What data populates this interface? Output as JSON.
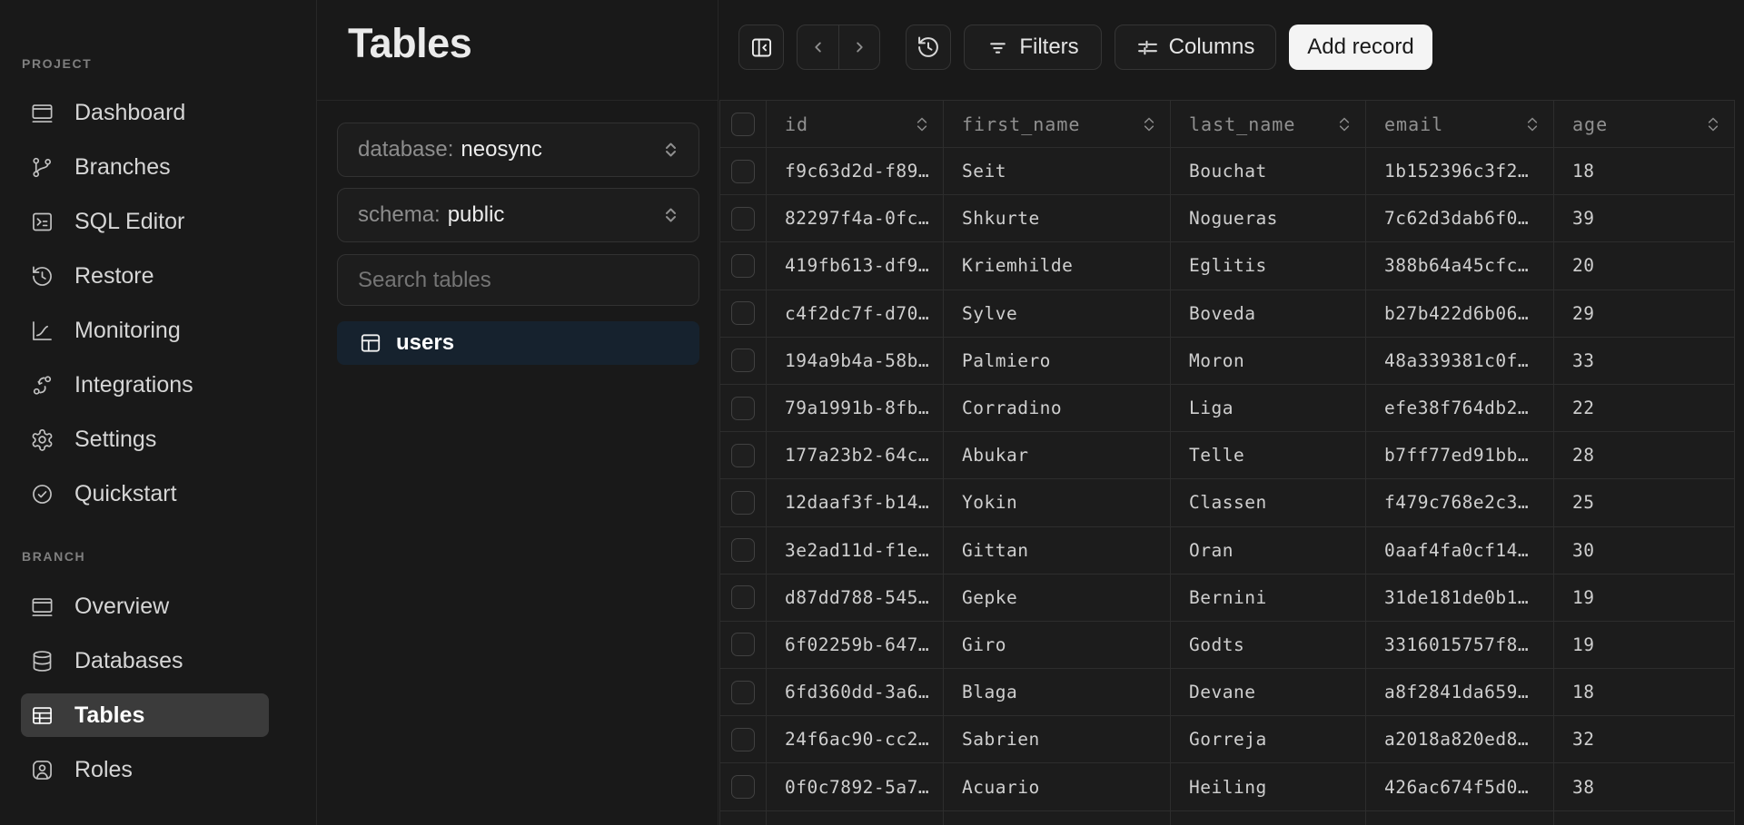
{
  "sidebar": {
    "project": {
      "label": "PROJECT",
      "items": [
        "Dashboard",
        "Branches",
        "SQL Editor",
        "Restore",
        "Monitoring",
        "Integrations",
        "Settings",
        "Quickstart"
      ]
    },
    "branch": {
      "label": "BRANCH",
      "items": [
        "Overview",
        "Databases",
        "Tables",
        "Roles"
      ],
      "active_item": "Tables"
    }
  },
  "panel": {
    "title": "Tables",
    "database_select": {
      "label": "database:",
      "value": "neosync"
    },
    "schema_select": {
      "label": "schema:",
      "value": "public"
    },
    "search": {
      "placeholder": "Search tables"
    },
    "tables": [
      {
        "name": "users",
        "active": true
      }
    ]
  },
  "toolbar": {
    "filters_label": "Filters",
    "columns_label": "Columns",
    "add_record_label": "Add record"
  },
  "table": {
    "columns": [
      "id",
      "first_name",
      "last_name",
      "email",
      "age"
    ],
    "rows": [
      {
        "id": "f9c63d2d-f89…",
        "first_name": "Seit",
        "last_name": "Bouchat",
        "email": "1b152396c3f2…",
        "age": "18"
      },
      {
        "id": "82297f4a-0fc…",
        "first_name": "Shkurte",
        "last_name": "Nogueras",
        "email": "7c62d3dab6f0…",
        "age": "39"
      },
      {
        "id": "419fb613-df9…",
        "first_name": "Kriemhilde",
        "last_name": "Eglitis",
        "email": "388b64a45cfc…",
        "age": "20"
      },
      {
        "id": "c4f2dc7f-d70…",
        "first_name": "Sylve",
        "last_name": "Boveda",
        "email": "b27b422d6b06…",
        "age": "29"
      },
      {
        "id": "194a9b4a-58b…",
        "first_name": "Palmiero",
        "last_name": "Moron",
        "email": "48a339381c0f…",
        "age": "33"
      },
      {
        "id": "79a1991b-8fb…",
        "first_name": "Corradino",
        "last_name": "Liga",
        "email": "efe38f764db2…",
        "age": "22"
      },
      {
        "id": "177a23b2-64c…",
        "first_name": "Abukar",
        "last_name": "Telle",
        "email": "b7ff77ed91bb…",
        "age": "28"
      },
      {
        "id": "12daaf3f-b14…",
        "first_name": "Yokin",
        "last_name": "Classen",
        "email": "f479c768e2c3…",
        "age": "25"
      },
      {
        "id": "3e2ad11d-f1e…",
        "first_name": "Gittan",
        "last_name": "Oran",
        "email": "0aaf4fa0cf14…",
        "age": "30"
      },
      {
        "id": "d87dd788-545…",
        "first_name": "Gepke",
        "last_name": "Bernini",
        "email": "31de181de0b1…",
        "age": "19"
      },
      {
        "id": "6f02259b-647…",
        "first_name": "Giro",
        "last_name": "Godts",
        "email": "3316015757f8…",
        "age": "19"
      },
      {
        "id": "6fd360dd-3a6…",
        "first_name": "Blaga",
        "last_name": "Devane",
        "email": "a8f2841da659…",
        "age": "18"
      },
      {
        "id": "24f6ac90-cc2…",
        "first_name": "Sabrien",
        "last_name": "Gorreja",
        "email": "a2018a820ed8…",
        "age": "32"
      },
      {
        "id": "0f0c7892-5a7…",
        "first_name": "Acuario",
        "last_name": "Heiling",
        "email": "426ac674f5d0…",
        "age": "38"
      }
    ]
  },
  "colors": {
    "page_bg": "#191919",
    "cell_bg": "#1c1c1c",
    "grid_border": "#2d2d2d",
    "selected_table_bg": "#16222e",
    "active_nav_bg": "#3b3b3b",
    "add_record_bg": "#f4f4f4"
  }
}
